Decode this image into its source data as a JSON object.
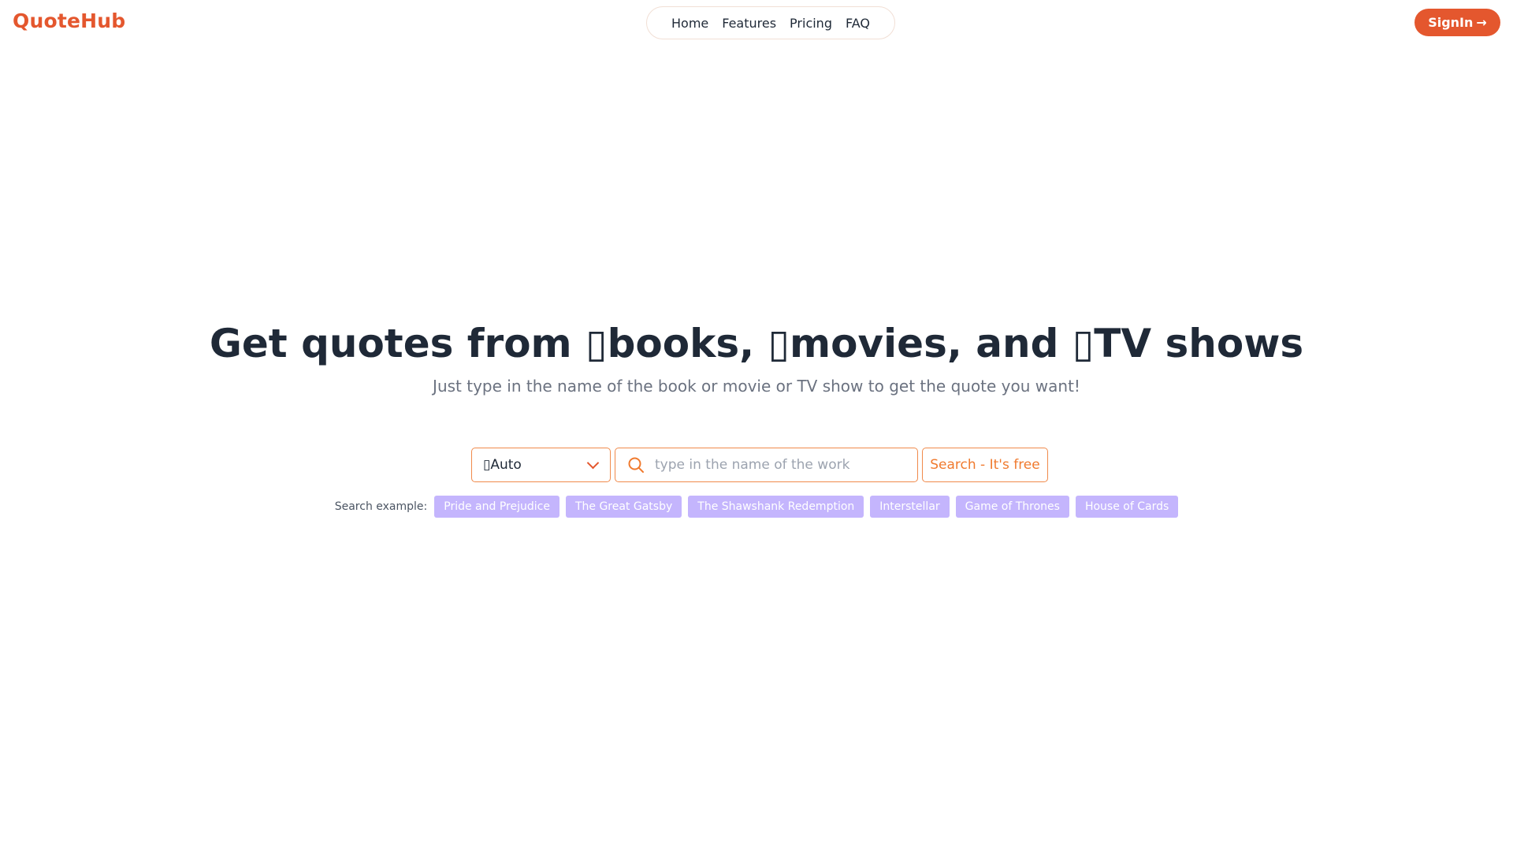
{
  "brand": {
    "name": "QuoteHub",
    "accent": "#e4572e",
    "chip_color": "#c4b5fd"
  },
  "nav": {
    "items": [
      {
        "label": "Home"
      },
      {
        "label": "Features"
      },
      {
        "label": "Pricing"
      },
      {
        "label": "FAQ"
      }
    ]
  },
  "signin": {
    "label": "SignIn",
    "arrow": "→"
  },
  "hero": {
    "title": "Get quotes from ▯books, ▯movies, and ▯TV shows",
    "subtitle": "Just type in the name of the book or movie or TV show to get the quote you want!"
  },
  "search": {
    "type_selected": "▯Auto",
    "placeholder": "type in the name of the work",
    "value": "",
    "button_label": "Search - It's free",
    "icon": "search-icon",
    "dropdown_icon": "chevron-down-icon"
  },
  "examples": {
    "label": "Search example:",
    "items": [
      "Pride and Prejudice",
      "The Great Gatsby",
      "The Shawshank Redemption",
      "Interstellar",
      "Game of Thrones",
      "House of Cards"
    ]
  }
}
